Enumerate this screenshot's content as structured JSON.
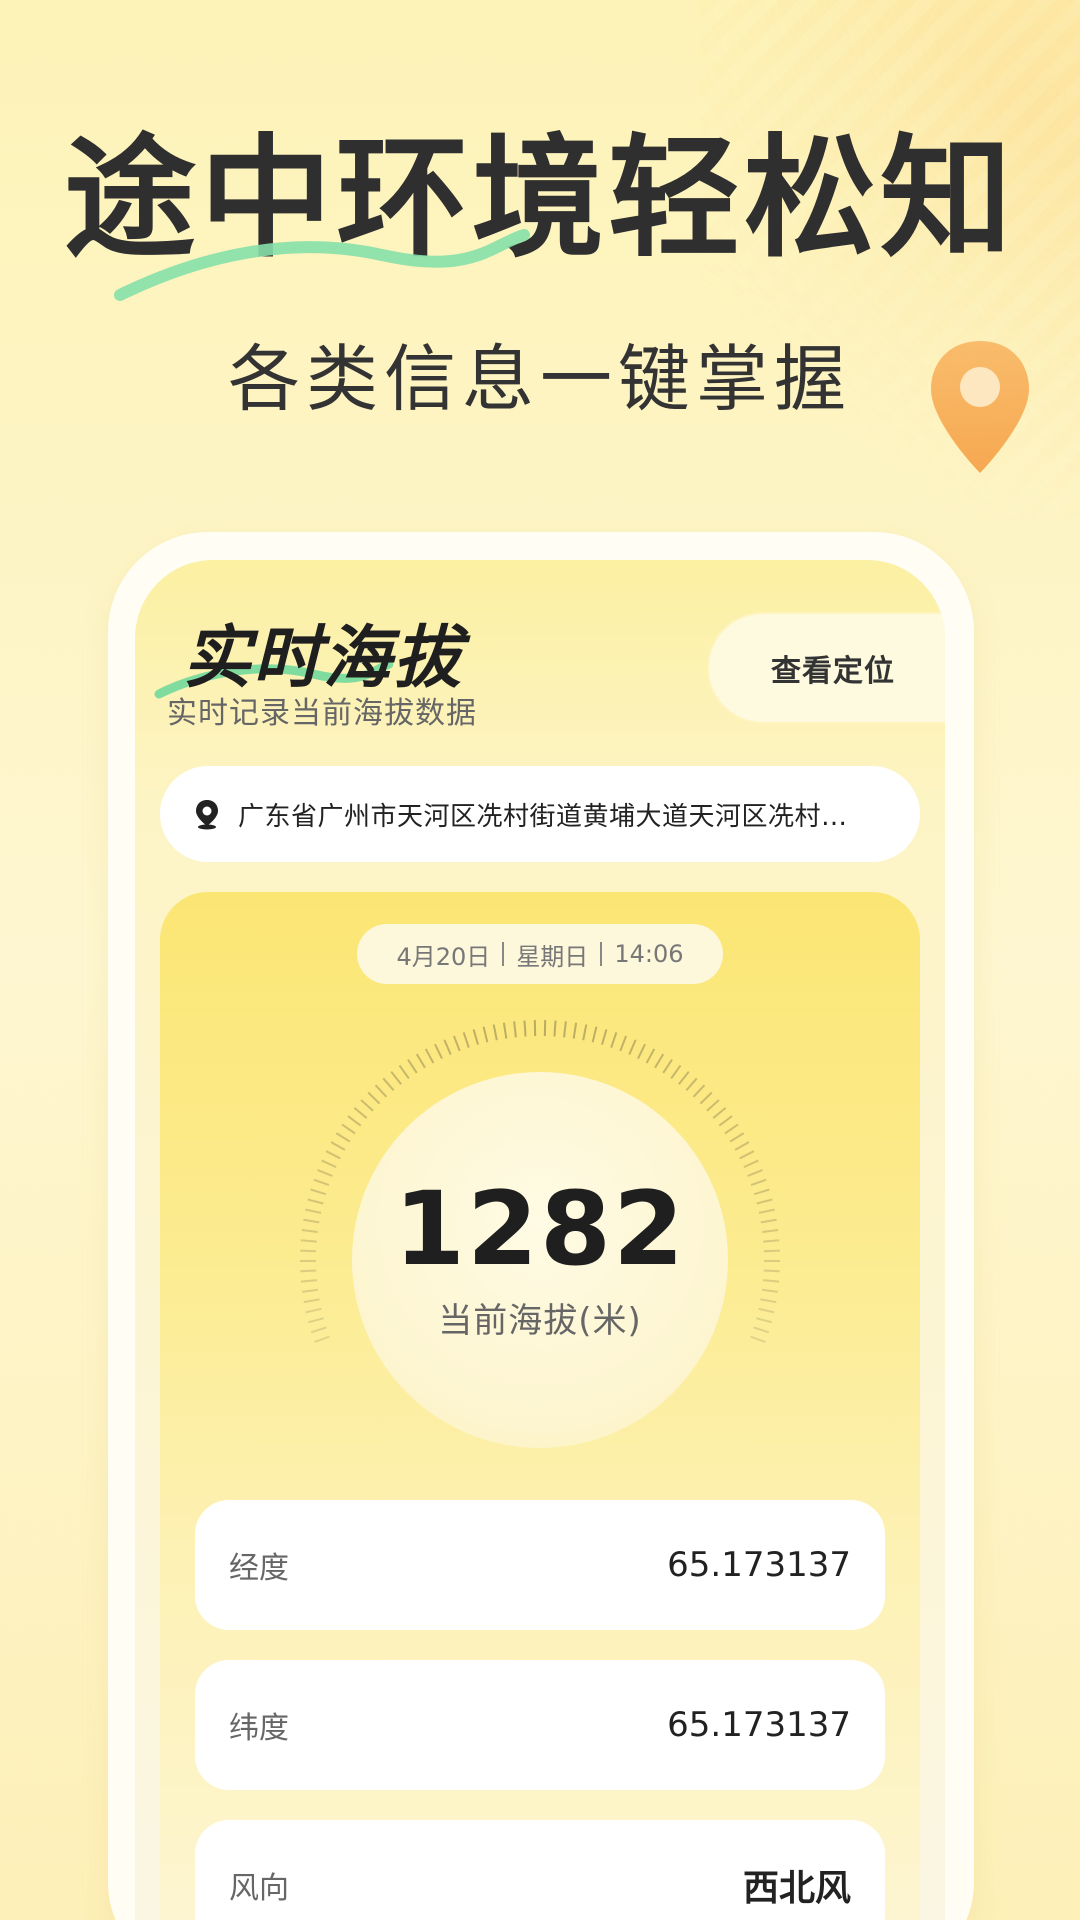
{
  "hero": {
    "headline": "途中环境轻松知",
    "subhead": "各类信息一键掌握"
  },
  "screen": {
    "title": "实时海拔",
    "subtitle": "实时记录当前海拔数据",
    "locate_button": "查看定位",
    "address": "广东省广州市天河区冼村街道黄埔大道天河区冼村…",
    "datetime": {
      "date": "4月20日",
      "weekday": "星期日",
      "time": "14:06"
    },
    "altitude": {
      "value": "1282",
      "label": "当前海拔(米)"
    },
    "info_rows": [
      {
        "label": "经度",
        "value": "65.173137"
      },
      {
        "label": "纬度",
        "value": "65.173137"
      },
      {
        "label": "风向",
        "value": "西北风"
      }
    ]
  },
  "colors": {
    "accent_green": "#7fdc9e",
    "pin_orange": "#f6a44f",
    "card_yellow": "#fbe674"
  },
  "icons": [
    "location-pin-icon",
    "map-pin-icon"
  ]
}
